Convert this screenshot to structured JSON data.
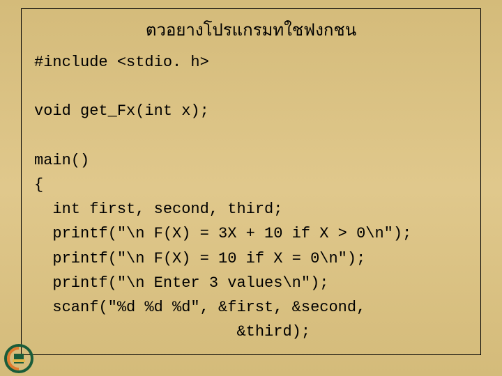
{
  "title": "ตวอยางโปรแกรมทใชฟงกชน",
  "code": {
    "l1": "#include <stdio. h>",
    "l2": "",
    "l3": "void get_Fx(int x);",
    "l4": "",
    "l5": "main()",
    "l6": "{",
    "l7": "  int first, second, third;",
    "l8": "  printf(\"\\n F(X) = 3X + 10 if X > 0\\n\");",
    "l9": "  printf(\"\\n F(X) = 10 if X = 0\\n\");",
    "l10": "  printf(\"\\n Enter 3 values\\n\");",
    "l11": "  scanf(\"%d %d %d\", &first, &second,",
    "l12": "                      &third);"
  }
}
